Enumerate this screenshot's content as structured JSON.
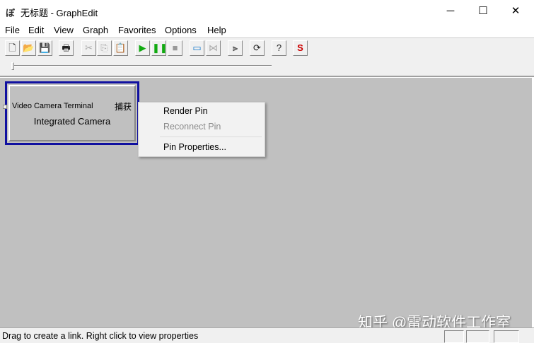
{
  "window": {
    "title": "无标题 - GraphEdit",
    "minimize": "─",
    "maximize": "☐",
    "close": "✕"
  },
  "menu": [
    "File",
    "Edit",
    "View",
    "Graph",
    "Favorites",
    "Options",
    "Help"
  ],
  "toolbar": [
    {
      "name": "new-icon",
      "glyph": "🗋"
    },
    {
      "name": "open-icon",
      "glyph": "📂"
    },
    {
      "name": "save-icon",
      "glyph": "💾"
    },
    {
      "name": "print-icon",
      "glyph": "🖶"
    },
    {
      "name": "cut-icon",
      "glyph": "✂"
    },
    {
      "name": "copy-icon",
      "glyph": "⎘"
    },
    {
      "name": "paste-icon",
      "glyph": "📋"
    },
    {
      "name": "play-icon",
      "glyph": "▶"
    },
    {
      "name": "pause-icon",
      "glyph": "❚❚"
    },
    {
      "name": "stop-icon",
      "glyph": "■"
    },
    {
      "name": "connect-icon",
      "glyph": "▭"
    },
    {
      "name": "disconnect-icon",
      "glyph": "⋈"
    },
    {
      "name": "graphedit-icon",
      "glyph": "⫸"
    },
    {
      "name": "refresh-icon",
      "glyph": "⟳"
    },
    {
      "name": "help-icon",
      "glyph": "?"
    },
    {
      "name": "s-icon",
      "glyph": "S"
    }
  ],
  "seek": {
    "position": 0
  },
  "filter": {
    "name": "Integrated Camera",
    "input_pin": "Video Camera Terminal",
    "output_pin": "捕获"
  },
  "context_menu": {
    "render": "Render Pin",
    "reconnect": "Reconnect Pin",
    "properties": "Pin Properties..."
  },
  "status": "Drag to create a link. Right click to view properties",
  "watermark": "知乎 @雷动软件工作室"
}
